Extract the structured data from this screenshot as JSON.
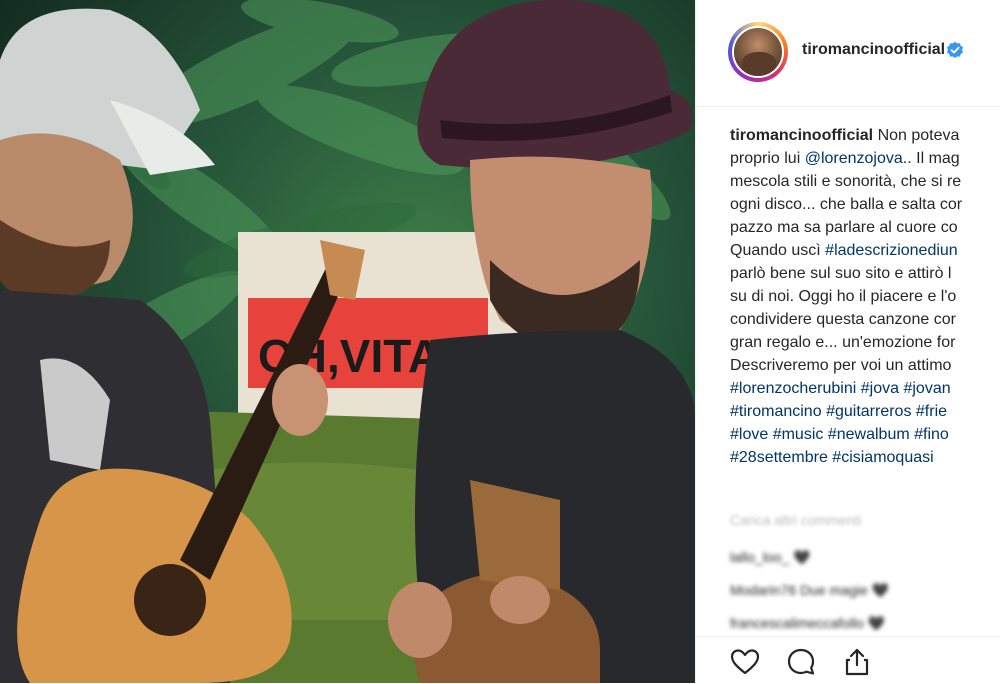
{
  "post": {
    "username": "tiromancinoofficial",
    "verified_icon": "verified-badge-icon",
    "caption_lines": [
      [
        {
          "t": "tiromancinoofficial",
          "k": "user"
        },
        {
          "t": " Non poteva",
          "k": "text"
        }
      ],
      [
        {
          "t": "proprio lui ",
          "k": "text"
        },
        {
          "t": "@lorenzojova",
          "k": "link"
        },
        {
          "t": ".. Il mag",
          "k": "text"
        }
      ],
      [
        {
          "t": "mescola stili e sonorità, che si re",
          "k": "text"
        }
      ],
      [
        {
          "t": "ogni disco... che balla e salta cor",
          "k": "text"
        }
      ],
      [
        {
          "t": "pazzo ma sa parlare al cuore co",
          "k": "text"
        }
      ],
      [
        {
          "t": "Quando uscì ",
          "k": "text"
        },
        {
          "t": "#ladescrizionediun",
          "k": "link"
        }
      ],
      [
        {
          "t": "parlò bene sul suo sito e attirò l",
          "k": "text"
        }
      ],
      [
        {
          "t": "su di noi. Oggi ho il piacere e l'o",
          "k": "text"
        }
      ],
      [
        {
          "t": "condividere questa canzone cor",
          "k": "text"
        }
      ],
      [
        {
          "t": "gran regalo e... un'emozione for",
          "k": "text"
        }
      ],
      [
        {
          "t": "Descriveremo per voi un attimo",
          "k": "text"
        }
      ],
      [
        {
          "t": "#lorenzocherubini",
          "k": "link"
        },
        {
          "t": " ",
          "k": "text"
        },
        {
          "t": "#jova",
          "k": "link"
        },
        {
          "t": " ",
          "k": "text"
        },
        {
          "t": "#jovan",
          "k": "link"
        }
      ],
      [
        {
          "t": "#tiromancino",
          "k": "link"
        },
        {
          "t": " ",
          "k": "text"
        },
        {
          "t": "#guitarreros",
          "k": "link"
        },
        {
          "t": " ",
          "k": "text"
        },
        {
          "t": "#frie",
          "k": "link"
        }
      ],
      [
        {
          "t": "#love",
          "k": "link"
        },
        {
          "t": " ",
          "k": "text"
        },
        {
          "t": "#music",
          "k": "link"
        },
        {
          "t": " ",
          "k": "text"
        },
        {
          "t": "#newalbum",
          "k": "link"
        },
        {
          "t": " ",
          "k": "text"
        },
        {
          "t": "#fino",
          "k": "link"
        }
      ],
      [
        {
          "t": "#28settembre",
          "k": "link"
        },
        {
          "t": " ",
          "k": "text"
        },
        {
          "t": "#cisiamoquasi",
          "k": "link"
        }
      ]
    ],
    "load_more": "Carica altri commenti",
    "comments": [
      "lallo_loo_ 🖤",
      "Modarin76 Due magie 🖤",
      "francescalimeccafollo 🖤"
    ]
  },
  "photo": {
    "sign_text": "OH,VITA"
  },
  "colors": {
    "link": "#003569",
    "verified": "#3897f0",
    "text": "#262626"
  },
  "actions": {
    "like_icon": "heart-icon",
    "comment_icon": "comment-icon",
    "share_icon": "share-icon"
  }
}
